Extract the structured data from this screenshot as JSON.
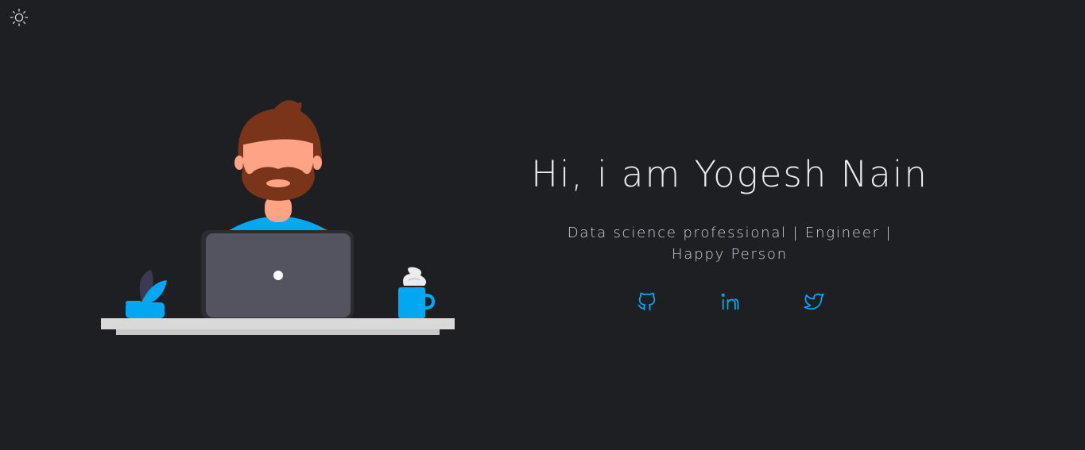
{
  "header": {
    "theme_toggle_icon": "sun-icon"
  },
  "hero": {
    "title": "Hi, i am Yogesh Nain",
    "subtitle": "Data science professional | Engineer | Happy Person"
  },
  "socials": [
    {
      "icon": "github-icon",
      "network": "github"
    },
    {
      "icon": "linkedin-icon",
      "network": "linkedin"
    },
    {
      "icon": "twitter-icon",
      "network": "twitter"
    }
  ],
  "colors": {
    "background": "#1e1f23",
    "accent": "#00a8f3",
    "text": "#e9ecf1",
    "laptop": "#53545f",
    "skin": "#fea385",
    "hair": "#7a3419",
    "desk": "#d9d9d9"
  }
}
